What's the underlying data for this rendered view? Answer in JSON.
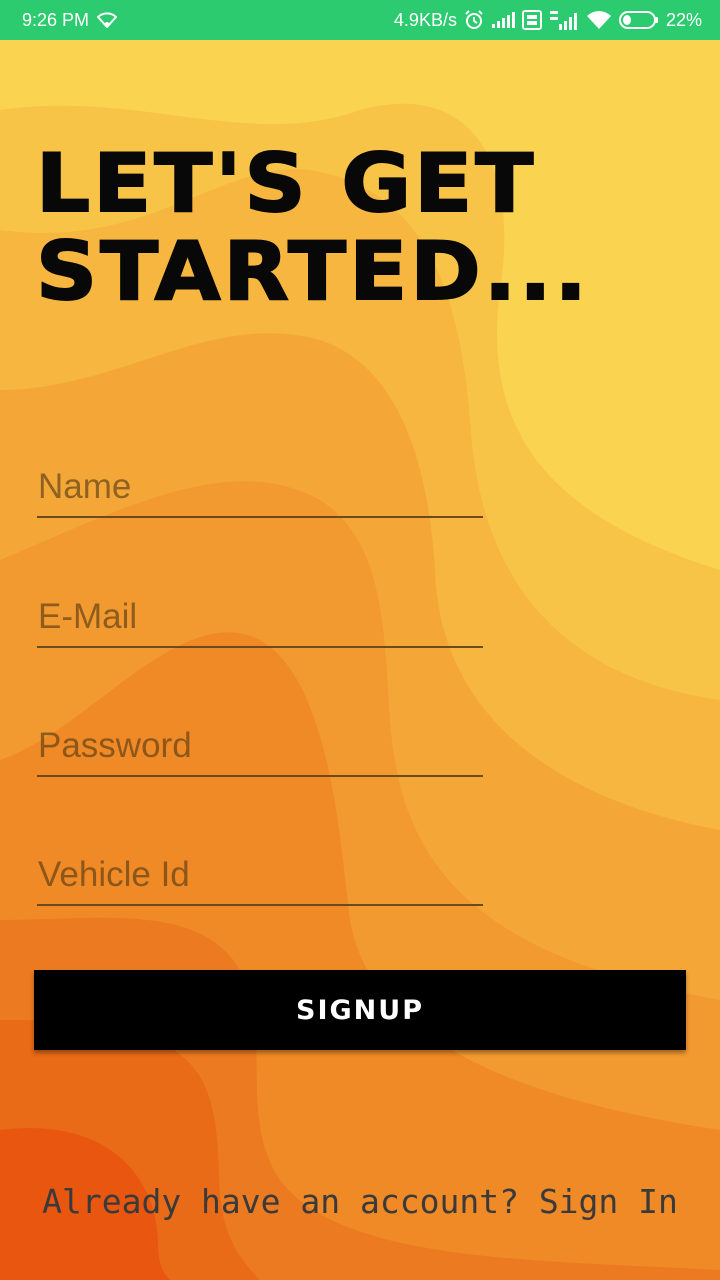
{
  "status_bar": {
    "time": "9:26 PM",
    "network_speed": "4.9KB/s",
    "battery_percent": "22%",
    "icons": [
      "wifi-icon",
      "alarm-icon",
      "signal-icon",
      "volte-icon",
      "lte-signal-icon",
      "wifi-icon",
      "battery-icon"
    ],
    "color": "#2DCB70"
  },
  "headline": {
    "line1": "LET'S GET",
    "line2": "STARTED..."
  },
  "form": {
    "name_placeholder": "Name",
    "email_placeholder": "E-Mail",
    "password_placeholder": "Password",
    "vehicle_placeholder": "Vehicle Id",
    "signup_label": "SIGNUP"
  },
  "footer": {
    "prompt": "Already have an account? ",
    "signin_label": "Sign In"
  },
  "colors": {
    "bg_yellow": "#FAD350",
    "bg_orange": "#F5A030",
    "bg_deep": "#E8460A",
    "button": "#000000"
  }
}
